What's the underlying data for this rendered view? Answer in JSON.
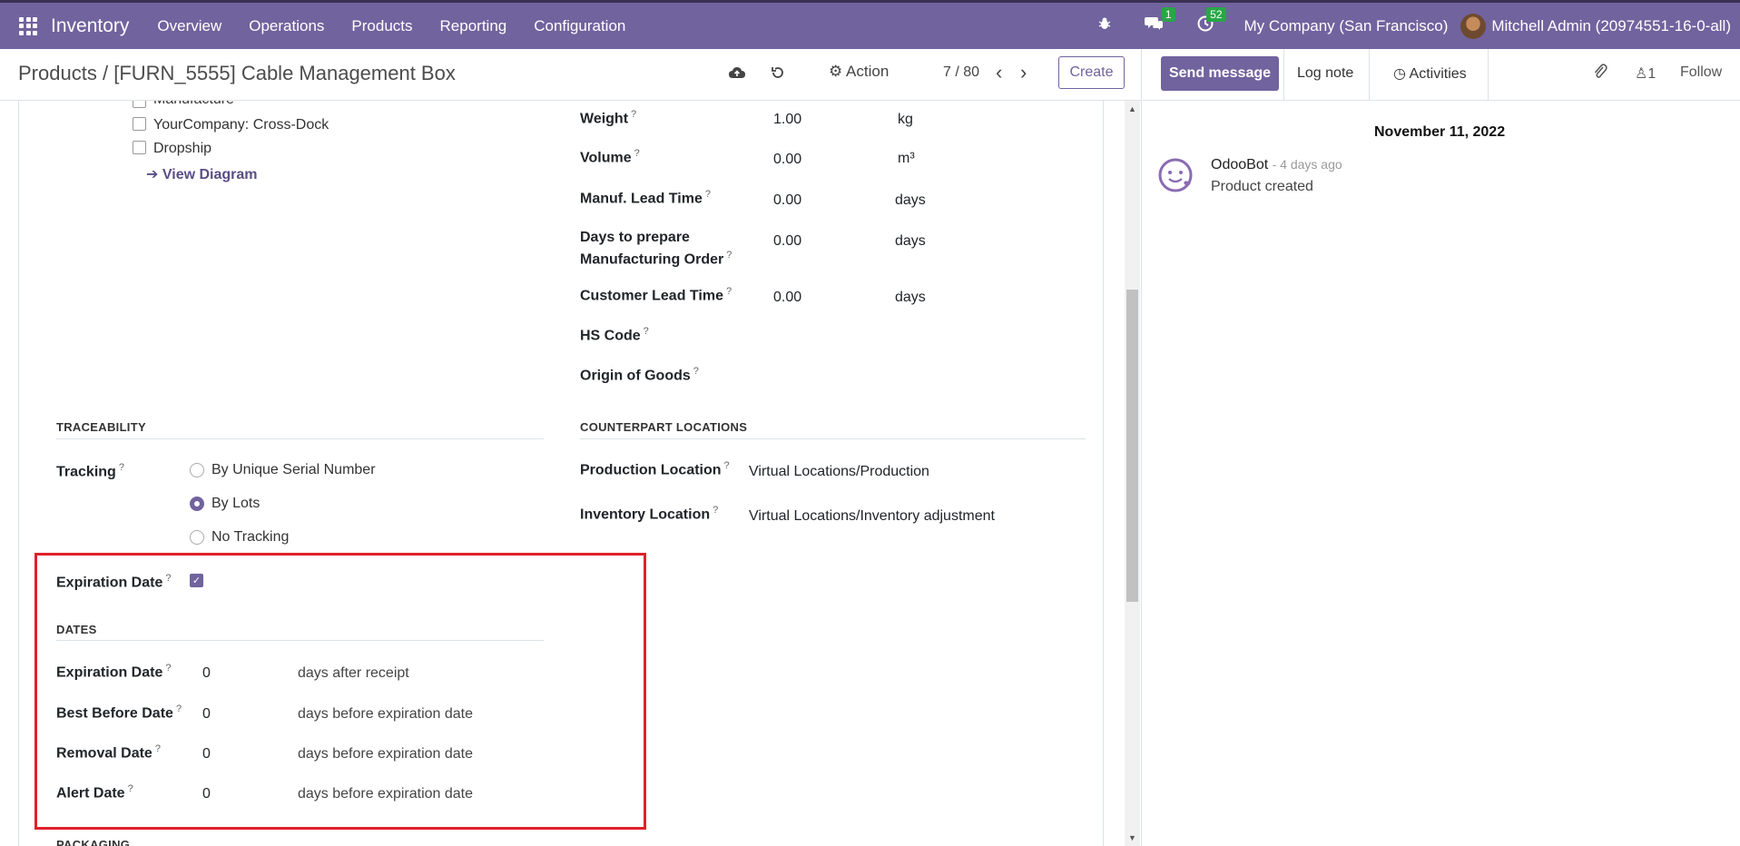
{
  "topbar": {
    "app_name": "Inventory",
    "menu": [
      "Overview",
      "Operations",
      "Products",
      "Reporting",
      "Configuration"
    ],
    "messages_count": "1",
    "activities_count": "52",
    "company": "My Company (San Francisco)",
    "user": "Mitchell Admin (20974551-16-0-all)"
  },
  "control": {
    "breadcrumb_parent": "Products",
    "breadcrumb_sep": "/",
    "breadcrumb_current": "[FURN_5555] Cable Management Box",
    "action_label": "Action",
    "pager": "7 / 80",
    "create_label": "Create"
  },
  "chatter": {
    "send_message": "Send message",
    "log_note": "Log note",
    "activities": "Activities",
    "followers_count": "1",
    "follow": "Follow",
    "date": "November 11, 2022",
    "author": "OdooBot",
    "time": "- 4 days ago",
    "message": "Product created"
  },
  "routes": {
    "items": [
      "Manufacture",
      "YourCompany: Cross-Dock",
      "Dropship"
    ],
    "view_diagram": "View Diagram"
  },
  "logistics": {
    "weight_label": "Weight",
    "weight_value": "1.00",
    "weight_unit": "kg",
    "volume_label": "Volume",
    "volume_value": "0.00",
    "volume_unit": "m³",
    "manuf_lead_label": "Manuf. Lead Time",
    "manuf_lead_value": "0.00",
    "manuf_lead_unit": "days",
    "days_prepare_label_1": "Days to prepare",
    "days_prepare_label_2": "Manufacturing Order",
    "days_prepare_value": "0.00",
    "days_prepare_unit": "days",
    "customer_lead_label": "Customer Lead Time",
    "customer_lead_value": "0.00",
    "customer_lead_unit": "days",
    "hs_code_label": "HS Code",
    "origin_label": "Origin of Goods"
  },
  "traceability": {
    "title": "TRACEABILITY",
    "tracking_label": "Tracking",
    "options": [
      "By Unique Serial Number",
      "By Lots",
      "No Tracking"
    ],
    "selected": "By Lots"
  },
  "counterpart": {
    "title": "COUNTERPART LOCATIONS",
    "production_label": "Production Location",
    "production_value": "Virtual Locations/Production",
    "inventory_label": "Inventory Location",
    "inventory_value": "Virtual Locations/Inventory adjustment"
  },
  "expiration": {
    "label": "Expiration Date",
    "checked": true
  },
  "dates": {
    "title": "DATES",
    "rows": [
      {
        "label": "Expiration Date",
        "value": "0",
        "suffix": "days after receipt"
      },
      {
        "label": "Best Before Date",
        "value": "0",
        "suffix": "days before expiration date"
      },
      {
        "label": "Removal Date",
        "value": "0",
        "suffix": "days before expiration date"
      },
      {
        "label": "Alert Date",
        "value": "0",
        "suffix": "days before expiration date"
      }
    ]
  },
  "packaging": {
    "title": "PACKAGING"
  },
  "colors": {
    "brand": "#71639e",
    "highlight": "#e0202a",
    "badge": "#28a745"
  }
}
